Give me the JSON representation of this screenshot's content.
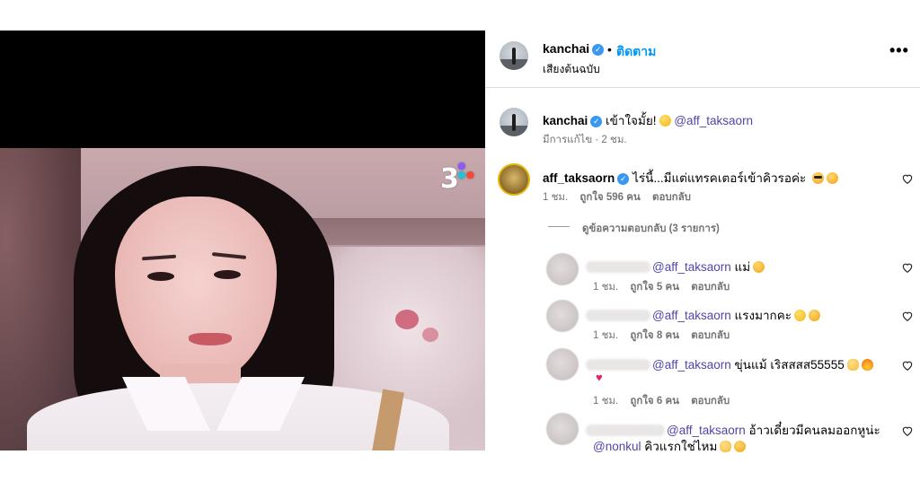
{
  "media": {
    "channel_logo": "3",
    "mute_icon": "speaker-muted-icon"
  },
  "post_header": {
    "username": "kanchai",
    "separator": "•",
    "follow_label": "ติดตาม",
    "audio_label": "เสียงต้นฉบับ",
    "more_icon": "•••"
  },
  "caption": {
    "username": "kanchai",
    "text": "เข้าใจมั้ย!",
    "mention": "@aff_taksaorn",
    "meta": "มีการแก้ไข · 2 ชม."
  },
  "comments": [
    {
      "username": "aff_taksaorn",
      "text": "ไร่นี้...มีแต่แทรคเตอร์เข้าคิวรอค่ะ",
      "time": "1 ชม.",
      "likes": "ถูกใจ 596 คน",
      "reply_label": "ตอบกลับ"
    }
  ],
  "view_replies_label": "ดูข้อความตอบกลับ (3 รายการ)",
  "replies": [
    {
      "mention": "@aff_taksaorn",
      "text": "แม่",
      "line2_mention": "",
      "line2_text": "",
      "time": "1 ชม.",
      "likes": "ถูกใจ 5 คน",
      "reply_label": "ตอบกลับ"
    },
    {
      "mention": "@aff_taksaorn",
      "text": "แรงมากคะ",
      "line2_mention": "",
      "line2_text": "",
      "time": "1 ชม.",
      "likes": "ถูกใจ 8 คน",
      "reply_label": "ตอบกลับ"
    },
    {
      "mention": "@aff_taksaorn",
      "text": "ขุ่นแม้ เริสสสส55555",
      "line2_mention": "",
      "line2_text": "",
      "time": "1 ชม.",
      "likes": "ถูกใจ 6 คน",
      "reply_label": "ตอบกลับ"
    },
    {
      "mention": "@aff_taksaorn",
      "text": "อ้าวเดี๋ยวมีคนลมออกหูน่ะ",
      "line2_mention": "@nonkul",
      "line2_text": "คิวแรกใช่ไหม",
      "time": "",
      "likes": "",
      "reply_label": ""
    }
  ],
  "colors": {
    "link_blue": "#0095f6",
    "mention_purple": "#4f46a8",
    "verified_blue": "#3897f0",
    "meta_gray": "#737373"
  }
}
